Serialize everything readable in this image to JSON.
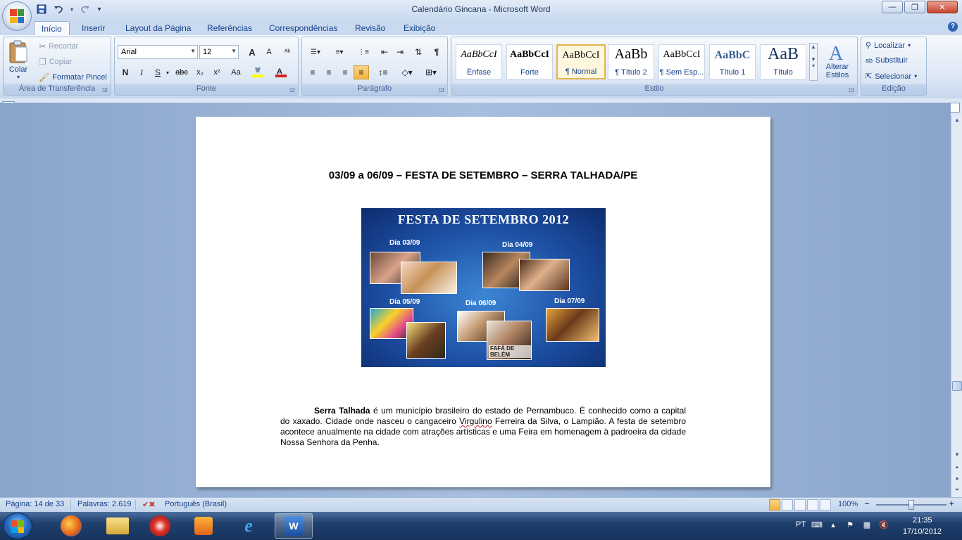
{
  "window": {
    "title": "Calendário Gincana - Microsoft Word",
    "controls": {
      "minimize": "—",
      "maximize": "❐",
      "close": "✕"
    }
  },
  "qat": {
    "save": "save-icon",
    "undo": "undo-icon",
    "redo": "redo-icon",
    "customize": "▾"
  },
  "tabs": [
    "Início",
    "Inserir",
    "Layout da Página",
    "Referências",
    "Correspondências",
    "Revisão",
    "Exibição"
  ],
  "clipboard": {
    "label": "Área de Transferência",
    "paste": "Colar",
    "cut": "Recortar",
    "copy": "Copiar",
    "format_painter": "Formatar Pincel"
  },
  "font": {
    "label": "Fonte",
    "family": "Arial",
    "size": "12",
    "grow": "A",
    "shrink": "A",
    "bold": "N",
    "italic": "I",
    "underline": "S",
    "strike": "abc",
    "subscript": "x₂",
    "superscript": "x²",
    "case": "Aa",
    "highlight_color": "#ffff00",
    "font_color": "#d32020"
  },
  "paragraph": {
    "label": "Parágrafo",
    "pilcrow": "¶"
  },
  "styles": {
    "label": "Estilo",
    "items": [
      {
        "sample": "AaBbCcI",
        "name": "Ênfase"
      },
      {
        "sample": "AaBbCcI",
        "name": "Forte"
      },
      {
        "sample": "AaBbCcI",
        "name": "¶ Normal"
      },
      {
        "sample": "AaBb",
        "name": "¶ Título 2"
      },
      {
        "sample": "AaBbCcI",
        "name": "¶ Sem Esp..."
      },
      {
        "sample": "AaBbC",
        "name": "Título 1"
      },
      {
        "sample": "AaB",
        "name": "Título"
      }
    ],
    "change_styles": "Alterar Estilos"
  },
  "editing": {
    "label": "Edição",
    "find": "Localizar",
    "replace": "Substituir",
    "select": "Selecionar"
  },
  "document": {
    "heading": "03/09 a 06/09 – FESTA DE SETEMBRO – SERRA TALHADA/PE",
    "poster": {
      "title": "FESTA DE SETEMBRO 2012",
      "days": [
        "Dia 03/09",
        "Dia 04/09",
        "Dia 05/09",
        "Dia 06/09",
        "Dia 07/09"
      ],
      "photo_captions": [
        "FAFÁ DE BELÉM"
      ]
    },
    "paragraph": {
      "bold_lead": "Serra Talhada",
      "text1": " é um município brasileiro do estado de Pernambuco. É conhecido como a capital do xaxado. Cidade onde nasceu o cangaceiro ",
      "misspelled": "Virgulino",
      "text2": " Ferreira da Silva, o Lampião. A festa de setembro acontece anualmente na cidade com atrações artísticas e uma Feira em homenagem à padroeira da cidade Nossa Senhora da Penha."
    }
  },
  "status": {
    "page": "Página: 14 de 33",
    "words": "Palavras: 2.619",
    "language": "Português (Brasil)",
    "zoom": "100%",
    "zoom_minus": "−",
    "zoom_plus": "+"
  },
  "taskbar": {
    "lang": "PT",
    "time": "21:35",
    "date": "17/10/2012"
  }
}
